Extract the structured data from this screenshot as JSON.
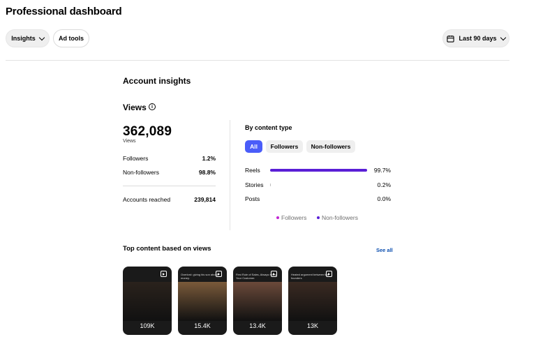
{
  "header": {
    "title": "Professional dashboard"
  },
  "toolbar": {
    "insights_label": "Insights",
    "ad_tools_label": "Ad tools",
    "date_range_label": "Last 90 days"
  },
  "account_insights": {
    "title": "Account insights"
  },
  "views": {
    "title": "Views",
    "total": "362,089",
    "total_label": "Views",
    "followers_label": "Followers",
    "followers_value": "1.2%",
    "non_followers_label": "Non-followers",
    "non_followers_value": "98.8%",
    "accounts_reached_label": "Accounts reached",
    "accounts_reached_value": "239,814"
  },
  "by_content_type": {
    "title": "By content type",
    "filters": [
      "All",
      "Followers",
      "Non-followers"
    ],
    "active_filter": "All",
    "rows": [
      {
        "label": "Reels",
        "value": "99.7%",
        "percent": 99.7
      },
      {
        "label": "Stories",
        "value": "0.2%",
        "percent": 0.2
      },
      {
        "label": "Posts",
        "value": "0.0%",
        "percent": 0.0
      }
    ],
    "legend": [
      {
        "label": "Followers",
        "color": "#c026d3"
      },
      {
        "label": "Non-followers",
        "color": "#5a1fd6"
      }
    ]
  },
  "top_content": {
    "title": "Top content based on views",
    "see_all_label": "See all",
    "items": [
      {
        "views": "109K",
        "caption": "",
        "color": "#2a221c"
      },
      {
        "views": "15.4K",
        "caption": "Overlord: giving his son about money.",
        "color": "#7a5a3a"
      },
      {
        "views": "13.4K",
        "caption": "First Rule of Sales, Always Know Your Customer.",
        "color": "#6b4a3a"
      },
      {
        "views": "13K",
        "caption": "Heated argument between the founders",
        "color": "#3a2a22"
      }
    ]
  },
  "colors": {
    "accent": "#4a5df9",
    "bar": "#5a1fd6",
    "link": "#0c4fb0"
  }
}
